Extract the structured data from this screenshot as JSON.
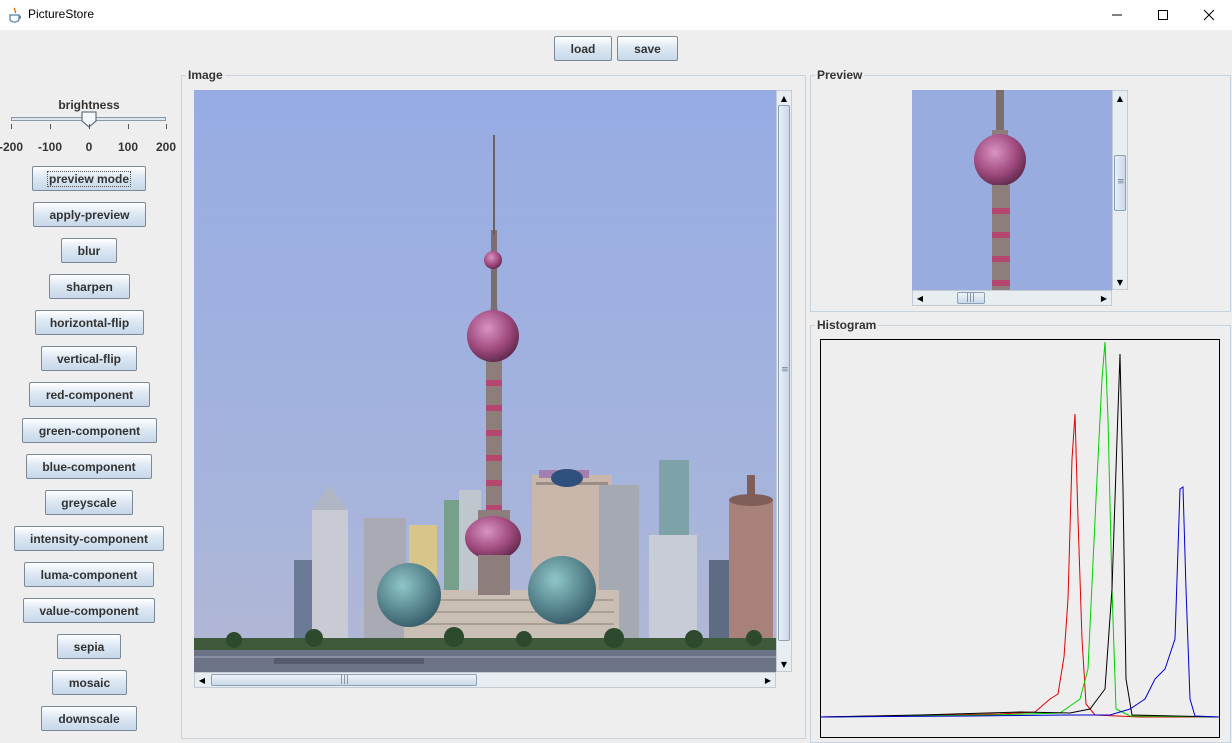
{
  "window": {
    "title": "PictureStore",
    "controls": {
      "minimize": "—",
      "maximize": "☐",
      "close": "✕"
    }
  },
  "toolbar": {
    "load_label": "load",
    "save_label": "save"
  },
  "brightness": {
    "label": "brightness",
    "ticks": [
      "-200",
      "-100",
      "0",
      "100",
      "200"
    ],
    "min": -200,
    "max": 200,
    "value": 0
  },
  "operations": [
    "preview mode",
    "apply-preview",
    "blur",
    "sharpen",
    "horizontal-flip",
    "vertical-flip",
    "red-component",
    "green-component",
    "blue-component",
    "greyscale",
    "intensity-component",
    "luma-component",
    "value-component",
    "sepia",
    "mosaic",
    "downscale"
  ],
  "panels": {
    "image_title": "Image",
    "preview_title": "Preview",
    "histogram_title": "Histogram"
  },
  "colors": {
    "sky": "#9bb0e0",
    "red": "#e00000",
    "green": "#00d000",
    "blue": "#0000d0",
    "black": "#000000",
    "button_top": "#ffffff",
    "button_bottom": "#c7d8ea"
  }
}
